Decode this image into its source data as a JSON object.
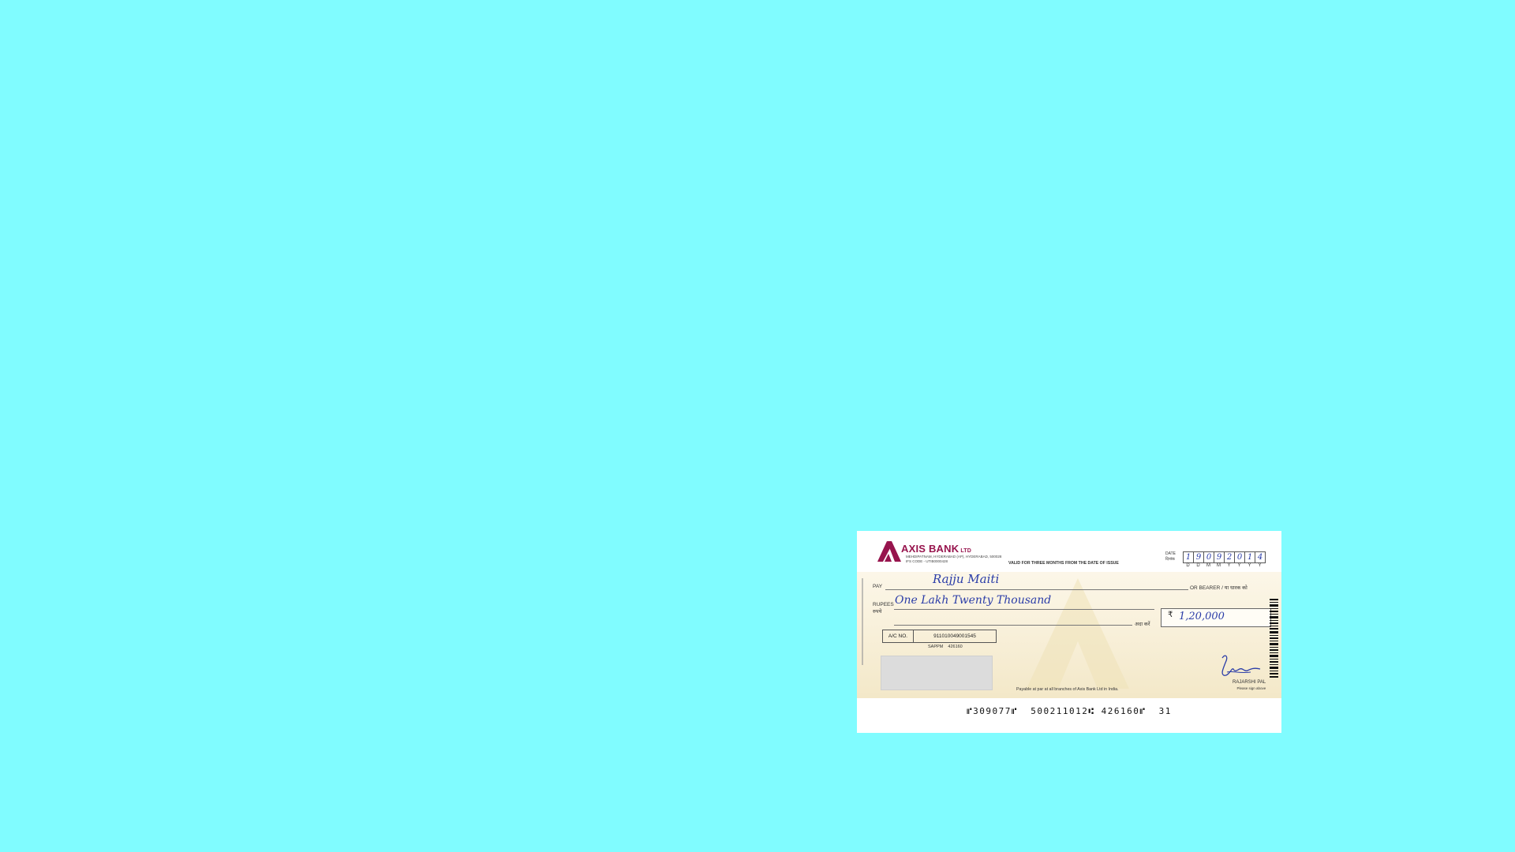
{
  "cheque": {
    "bank_name": "AXIS BANK",
    "bank_suffix": "LTD",
    "branch_address": "MEHDIPATNAM, HYDERABAD (AP), HYDERABAD, 500028",
    "ifs_code": "IFS CODE - UTIB0000428",
    "validity": "VALID FOR THREE MONTHS FROM THE DATE OF ISSUE",
    "date_label_en": "DATE",
    "date_label_hi": "दिनांक",
    "date_digits": [
      "1",
      "9",
      "0",
      "9",
      "2",
      "0",
      "1",
      "4"
    ],
    "date_format": [
      "D",
      "D",
      "M",
      "M",
      "Y",
      "Y",
      "Y",
      "Y"
    ],
    "pay_label": "PAY",
    "payee": "Rajju Maiti",
    "bearer_label": "OR BEARER / या धारक को",
    "rupees_label_en": "RUPEES",
    "rupees_label_hi": "रुपये",
    "amount_words": "One Lakh Twenty Thousand",
    "ada_karen": "अदा करें",
    "rupee_symbol": "₹",
    "amount_figures": "1,20,000",
    "acno_label": "A/C NO.",
    "account_number": "911010049001545",
    "code_label": "SAPPM",
    "code_value": "426160",
    "payable_note": "Payable at par at all branches of Axis Bank Ltd in India.",
    "signatory": "RAJARSHI PAL",
    "sign_note": "Please sign above",
    "micr_line": "⑈309077⑈  500211012⑆ 426160⑈  31",
    "brand_color": "#97144d",
    "ink_color": "#2b3da8"
  }
}
